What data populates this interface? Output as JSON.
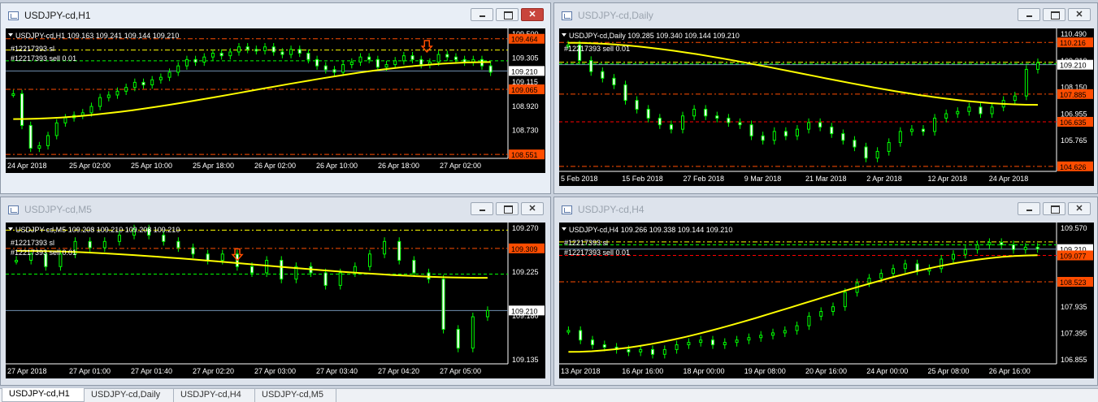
{
  "windows": [
    {
      "id": "w1",
      "title": "USDJPY-cd,H1",
      "active": true,
      "info": "USDJPY-cd,H1  109.163 109.241 109.144 109.210",
      "order_labels": [
        "#12217393 sl",
        "#12217393 sell 0.01"
      ],
      "price_ticks": [
        "109.500",
        "109.305",
        "109.115",
        "108.920",
        "108.730",
        "108.540"
      ],
      "price_range": [
        108.52,
        109.52
      ],
      "badges": [
        {
          "text": "109.464",
          "value": 109.464,
          "bg": "#ff4d00"
        },
        {
          "text": "109.210",
          "value": 109.21,
          "bg": "#ffffff"
        },
        {
          "text": "109.065",
          "value": 109.065,
          "bg": "#ff4d00"
        },
        {
          "text": "108.551",
          "value": 108.551,
          "bg": "#ff4d00"
        }
      ],
      "lines": [
        {
          "value": 109.464,
          "color": "#ff4d00",
          "style": "dashdot"
        },
        {
          "value": 109.375,
          "color": "#ffff00",
          "style": "dashdot"
        },
        {
          "value": 109.29,
          "color": "#00ff00",
          "style": "dash"
        },
        {
          "value": 109.21,
          "color": "#7090b0",
          "style": "solid"
        },
        {
          "value": 109.065,
          "color": "#ff4d00",
          "style": "dashdot"
        },
        {
          "value": 108.551,
          "color": "#ff4d00",
          "style": "dashdot"
        }
      ],
      "time_labels": [
        "24 Apr 2018",
        "25 Apr 02:00",
        "25 Apr 10:00",
        "25 Apr 18:00",
        "26 Apr 02:00",
        "26 Apr 10:00",
        "26 Apr 18:00",
        "27 Apr 02:00"
      ],
      "candles": [
        109.03,
        108.78,
        108.6,
        108.62,
        108.7,
        108.8,
        108.84,
        108.86,
        108.88,
        108.93,
        109.0,
        109.02,
        109.05,
        109.08,
        109.12,
        109.1,
        109.14,
        109.16,
        109.2,
        109.25,
        109.3,
        109.28,
        109.32,
        109.35,
        109.33,
        109.36,
        109.4,
        109.38,
        109.37,
        109.4,
        109.36,
        109.34,
        109.38,
        109.35,
        109.3,
        109.25,
        109.22,
        109.2,
        109.26,
        109.28,
        109.32,
        109.3,
        109.24,
        109.26,
        109.29,
        109.33,
        109.3,
        109.26,
        109.28,
        109.34,
        109.32,
        109.3,
        109.28,
        109.3,
        109.25,
        109.2
      ],
      "ma": {
        "color": "#ffff00",
        "start": 108.83,
        "end": 109.28
      },
      "arrow": {
        "at": 0.86,
        "value": 109.36
      }
    },
    {
      "id": "w2",
      "title": "USDJPY-cd,Daily",
      "active": false,
      "info": "USDJPY-cd,Daily  109.285 109.340 109.144 109.210",
      "order_labels": [
        "#12217393 sell 0.01"
      ],
      "price_ticks": [
        "110.490",
        "109.210",
        "108.150",
        "106.955",
        "105.765",
        "104.570"
      ],
      "price_range": [
        104.4,
        110.7
      ],
      "badges": [
        {
          "text": "110.216",
          "value": 110.216,
          "bg": "#ff4d00"
        },
        {
          "text": "109.210",
          "value": 109.21,
          "bg": "#ffffff"
        },
        {
          "text": "107.885",
          "value": 107.885,
          "bg": "#ff4d00"
        },
        {
          "text": "106.635",
          "value": 106.635,
          "bg": "#ff4d00"
        },
        {
          "text": "104.626",
          "value": 104.626,
          "bg": "#ff4d00"
        }
      ],
      "lines": [
        {
          "value": 110.216,
          "color": "#ff4d00",
          "style": "dashdot"
        },
        {
          "value": 109.32,
          "color": "#ffff00",
          "style": "dashdot"
        },
        {
          "value": 109.25,
          "color": "#00ff00",
          "style": "dash"
        },
        {
          "value": 109.21,
          "color": "#7090b0",
          "style": "solid"
        },
        {
          "value": 107.885,
          "color": "#ff4d00",
          "style": "dashdot"
        },
        {
          "value": 106.635,
          "color": "#ff0000",
          "style": "dash"
        },
        {
          "value": 104.626,
          "color": "#ff4d00",
          "style": "dashdot"
        }
      ],
      "time_labels": [
        "5 Feb 2018",
        "15 Feb 2018",
        "27 Feb 2018",
        "9 Mar 2018",
        "21 Mar 2018",
        "2 Apr 2018",
        "12 Apr 2018",
        "24 Apr 2018"
      ],
      "candles": [
        110.1,
        109.4,
        108.9,
        108.6,
        108.3,
        107.6,
        107.2,
        106.8,
        106.5,
        106.3,
        106.9,
        107.2,
        106.9,
        106.8,
        106.6,
        106.5,
        106.0,
        105.8,
        106.2,
        106.0,
        106.3,
        106.6,
        106.4,
        106.1,
        105.8,
        105.5,
        105.0,
        105.3,
        105.7,
        106.2,
        106.3,
        106.2,
        106.8,
        107.0,
        107.1,
        107.3,
        107.0,
        107.3,
        107.6,
        107.8,
        109.0,
        109.3
      ],
      "ma": {
        "color": "#ffff00",
        "start": 110.2,
        "end": 107.4
      },
      "arrow": null
    },
    {
      "id": "w3",
      "title": "USDJPY-cd,M5",
      "active": false,
      "info": "USDJPY-cd,M5  109.208 109.210 109.208 109.210",
      "order_labels": [
        "#12217393 sl",
        "#12217393 sell 0.01"
      ],
      "price_ticks": [
        "109.270",
        "109.225",
        "109.180",
        "109.135"
      ],
      "price_range": [
        109.125,
        109.345
      ],
      "badges": [
        {
          "text": "109.309",
          "value": 109.309,
          "bg": "#ff4d00"
        },
        {
          "text": "109.210",
          "value": 109.21,
          "bg": "#ffffff"
        }
      ],
      "lines": [
        {
          "value": 109.338,
          "color": "#ffff00",
          "style": "dashdot"
        },
        {
          "value": 109.309,
          "color": "#ff4d00",
          "style": "dashdot"
        },
        {
          "value": 109.268,
          "color": "#00ff00",
          "style": "dash"
        },
        {
          "value": 109.21,
          "color": "#7090b0",
          "style": "solid"
        }
      ],
      "time_labels": [
        "27 Apr 2018",
        "27 Apr 01:00",
        "27 Apr 01:40",
        "27 Apr 02:20",
        "27 Apr 03:00",
        "27 Apr 03:40",
        "27 Apr 04:20",
        "27 Apr 05:00"
      ],
      "candles": [
        109.29,
        109.3,
        109.28,
        109.3,
        109.32,
        109.31,
        109.32,
        109.33,
        109.34,
        109.33,
        109.32,
        109.31,
        109.3,
        109.29,
        109.3,
        109.28,
        109.27,
        109.29,
        109.26,
        109.28,
        109.27,
        109.25,
        109.27,
        109.28,
        109.3,
        109.32,
        109.29,
        109.27,
        109.26,
        109.18,
        109.15,
        109.2,
        109.21
      ],
      "ma": {
        "color": "#ffff00",
        "start": 109.305,
        "end": 109.262
      },
      "arrow": {
        "at": 0.47,
        "value": 109.29
      }
    },
    {
      "id": "w4",
      "title": "USDJPY-cd,H4",
      "active": false,
      "info": "USDJPY-cd,H4  109.266 109.338 109.144 109.210",
      "order_labels": [
        "#12217393 sl",
        "#12217393 sell 0.01"
      ],
      "price_ticks": [
        "109.570",
        "109.210",
        "108.480",
        "107.935",
        "107.395",
        "106.855"
      ],
      "price_range": [
        106.8,
        109.7
      ],
      "badges": [
        {
          "text": "109.210",
          "value": 109.21,
          "bg": "#ffffff"
        },
        {
          "text": "109.077",
          "value": 109.077,
          "bg": "#ff4d00"
        },
        {
          "text": "108.523",
          "value": 108.523,
          "bg": "#ff4d00"
        }
      ],
      "lines": [
        {
          "value": 109.36,
          "color": "#ffff00",
          "style": "dashdot"
        },
        {
          "value": 109.3,
          "color": "#00ff00",
          "style": "dash"
        },
        {
          "value": 109.21,
          "color": "#7090b0",
          "style": "solid"
        },
        {
          "value": 109.077,
          "color": "#ff0000",
          "style": "dash"
        },
        {
          "value": 108.523,
          "color": "#ff4d00",
          "style": "dashdot"
        }
      ],
      "time_labels": [
        "13 Apr 2018",
        "16 Apr 16:00",
        "18 Apr 00:00",
        "19 Apr 08:00",
        "20 Apr 16:00",
        "24 Apr 00:00",
        "25 Apr 08:00",
        "26 Apr 16:00"
      ],
      "candles": [
        107.5,
        107.3,
        107.2,
        107.15,
        107.1,
        107.05,
        107.1,
        107.0,
        107.1,
        107.2,
        107.25,
        107.3,
        107.2,
        107.25,
        107.3,
        107.35,
        107.4,
        107.45,
        107.5,
        107.6,
        107.8,
        107.9,
        108.0,
        108.3,
        108.5,
        108.6,
        108.7,
        108.8,
        108.9,
        108.75,
        108.8,
        109.0,
        109.1,
        109.2,
        109.3,
        109.35,
        109.3,
        109.2,
        109.25,
        109.22
      ],
      "ma": {
        "color": "#ffff00",
        "start": 107.05,
        "end": 109.08
      },
      "arrow": null
    }
  ],
  "tabs": [
    "USDJPY-cd,H1",
    "USDJPY-cd,Daily",
    "USDJPY-cd,H4",
    "USDJPY-cd,M5"
  ],
  "colors": {
    "background": "#000000",
    "candle": "#00ff00",
    "grid_text": "#ffffff",
    "badge_text": "#000000"
  }
}
